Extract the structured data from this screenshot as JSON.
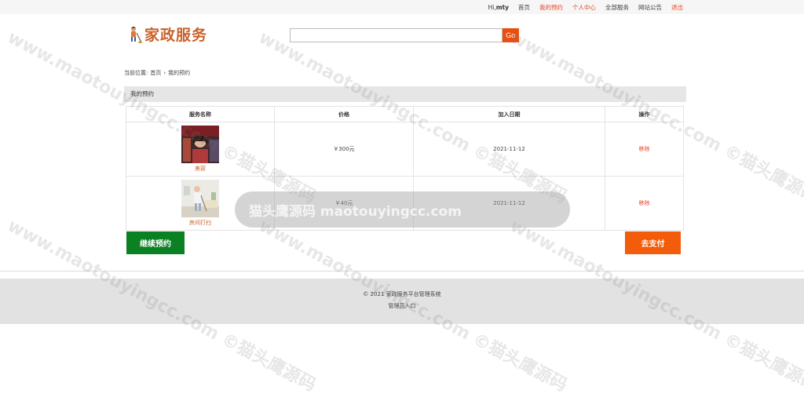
{
  "topnav": {
    "greeting_prefix": "Hi,",
    "username": "mty",
    "items": [
      {
        "label": "首页",
        "highlight": false
      },
      {
        "label": "我的预约",
        "highlight": true
      },
      {
        "label": "个人中心",
        "highlight": true
      },
      {
        "label": "全部服务",
        "highlight": false
      },
      {
        "label": "网站公告",
        "highlight": false
      },
      {
        "label": "退出",
        "highlight": true
      }
    ]
  },
  "logo": {
    "text": "家政服务",
    "icon": "cleaner-mascot-icon"
  },
  "search": {
    "value": "",
    "button_label": "Go"
  },
  "breadcrumb": {
    "prefix": "当前位置:",
    "home": "首页",
    "separator": "›",
    "current": "我的预约"
  },
  "panel": {
    "title": "我的预约"
  },
  "table": {
    "headers": [
      "服务名称",
      "价格",
      "加入日期",
      "操作"
    ],
    "rows": [
      {
        "name": "美容",
        "price": "￥300元",
        "date": "2021-11-12",
        "action": "移除"
      },
      {
        "name": "房间打扫",
        "price": "￥40元",
        "date": "2021-11-12",
        "action": "移除"
      }
    ]
  },
  "buttons": {
    "continue_label": "继续预约",
    "pay_label": "去支付"
  },
  "footer": {
    "copyright": "© 2021 家政服务平台管理系统",
    "admin_link": "管理员入口"
  },
  "watermark": {
    "bar_text": "猫头鹰源码 maotouyingcc.com",
    "tile_text": "www.maotouyingcc.com ©猫头鹰源码"
  },
  "colors": {
    "accent": "#ea4f12",
    "brand": "#c9622a",
    "continue": "#0b8124",
    "pay": "#f25c0a",
    "link_highlight": "#e8462a"
  }
}
